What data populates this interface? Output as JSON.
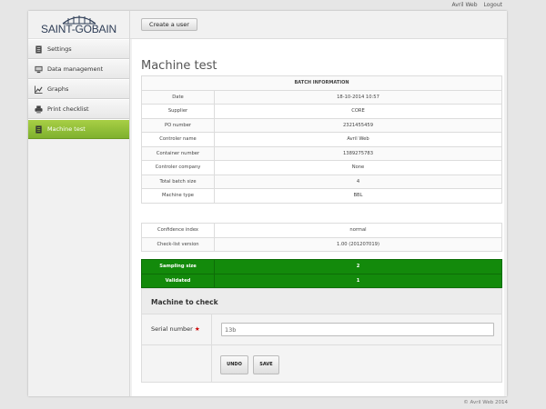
{
  "topbar": {
    "user": "Avril Web",
    "logout": "Logout"
  },
  "logo": {
    "text": "SAINT-GOBAIN"
  },
  "sidebar": {
    "items": [
      {
        "label": "Settings",
        "icon": "document-icon"
      },
      {
        "label": "Data management",
        "icon": "monitor-icon"
      },
      {
        "label": "Graphs",
        "icon": "line-chart-icon"
      },
      {
        "label": "Print checklist",
        "icon": "printer-icon"
      },
      {
        "label": "Machine test",
        "icon": "document-icon",
        "active": true
      }
    ]
  },
  "header": {
    "create_label": "Create a user"
  },
  "page": {
    "title": "Machine test"
  },
  "batch": {
    "heading": "BATCH INFORMATION",
    "rows": [
      {
        "label": "Date",
        "value": "18-10-2014 10:57"
      },
      {
        "label": "Supplier",
        "value": "CORE"
      },
      {
        "label": "PO number",
        "value": "2321455459"
      },
      {
        "label": "Controler name",
        "value": "Avril Web"
      },
      {
        "label": "Container number",
        "value": "1389275783"
      },
      {
        "label": "Controler company",
        "value": "None"
      },
      {
        "label": "Total batch size",
        "value": "4"
      },
      {
        "label": "Machine type",
        "value": "BBL"
      }
    ]
  },
  "extra": {
    "rows": [
      {
        "label": "Confidence index",
        "value": "normal"
      },
      {
        "label": "Check-list version",
        "value": "1.00 (201207019)"
      }
    ]
  },
  "status": {
    "rows": [
      {
        "label": "Sampling size",
        "value": "2"
      },
      {
        "label": "Validated",
        "value": "1"
      }
    ]
  },
  "machine_check": {
    "heading": "Machine to check",
    "serial_label": "Serial number",
    "required_mark": "★",
    "serial_value": "13b",
    "undo_label": "UNDO",
    "save_label": "SAVE"
  },
  "footer": {
    "text": "© Avril Web 2014"
  },
  "colors": {
    "accent_green": "#8bbd36",
    "status_green": "#138a0b",
    "logo_blue": "#2f3e57"
  }
}
